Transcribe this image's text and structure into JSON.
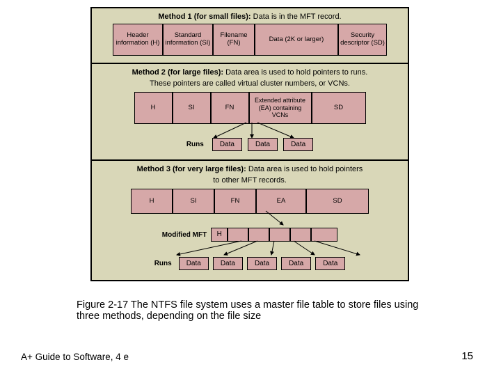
{
  "figure": {
    "method1": {
      "title_bold": "Method 1 (for small files):",
      "title_rest": " Data is in the MFT record.",
      "cells": [
        "Header information (H)",
        "Standard information (SI)",
        "Filename (FN)",
        "Data (2K or larger)",
        "Security descriptor (SD)"
      ]
    },
    "method2": {
      "title_bold": "Method 2 (for large files):",
      "title_rest": " Data area is used to hold pointers to runs.",
      "subtitle": "These pointers are called virtual cluster numbers, or VCNs.",
      "cells": [
        "H",
        "SI",
        "FN",
        "Extended attribute (EA) containing VCNs",
        "SD"
      ],
      "runs_label": "Runs",
      "data_boxes": [
        "Data",
        "Data",
        "Data"
      ]
    },
    "method3": {
      "title_bold": "Method 3 (for very large files):",
      "title_rest": " Data area is used to hold pointers",
      "subtitle": "to other MFT records.",
      "cells": [
        "H",
        "SI",
        "FN",
        "EA",
        "SD"
      ],
      "mod_label": "Modified MFT",
      "mod_h": "H",
      "runs_label": "Runs",
      "data_boxes": [
        "Data",
        "Data",
        "Data",
        "Data",
        "Data"
      ]
    }
  },
  "caption": "Figure 2-17 The NTFS file system uses a master file table to store files using three methods, depending on the file size",
  "footer_left": "A+ Guide to Software, 4 e",
  "footer_right": "15"
}
